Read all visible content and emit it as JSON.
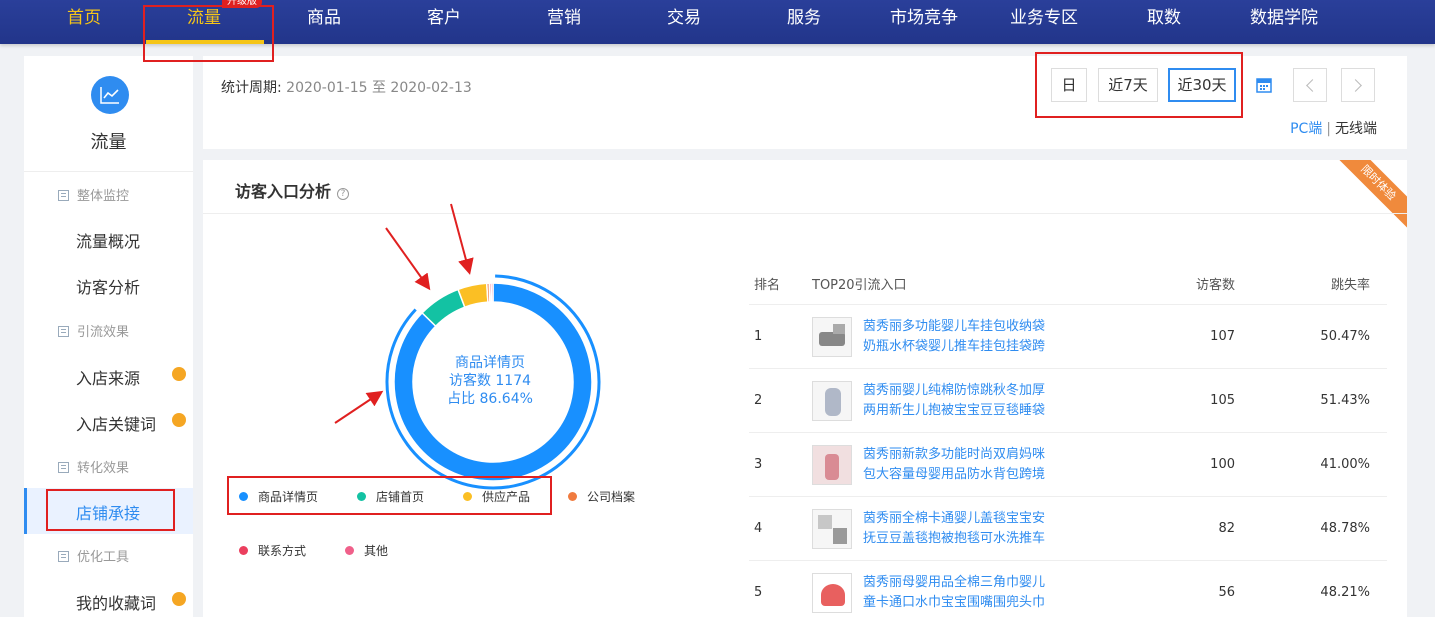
{
  "nav": {
    "items": [
      "首页",
      "流量",
      "商品",
      "客户",
      "营销",
      "交易",
      "服务",
      "市场竞争",
      "业务专区",
      "取数",
      "数据学院"
    ],
    "badge": "升级版",
    "active_index": 1
  },
  "sidebar": {
    "title": "流量",
    "groups": [
      {
        "label": "整体监控",
        "items": [
          "流量概况",
          "访客分析"
        ]
      },
      {
        "label": "引流效果",
        "items": [
          "入店来源",
          "入店关键词"
        ]
      },
      {
        "label": "转化效果",
        "items": [
          "店铺承接"
        ]
      },
      {
        "label": "优化工具",
        "items": [
          "我的收藏词"
        ]
      }
    ],
    "active_item": "店铺承接"
  },
  "header": {
    "period_label": "统计周期:",
    "period_value": "2020-01-15 至 2020-02-13",
    "buttons": [
      "日",
      "近7天",
      "近30天"
    ],
    "selected_button": "近30天",
    "device_pc": "PC端",
    "device_sep": "|",
    "device_wireless": "无线端"
  },
  "panel": {
    "title": "访客入口分析",
    "help_icon": "?",
    "ribbon": "限时体验",
    "donut_center": {
      "label": "商品详情页",
      "visits": "访客数 1174",
      "share": "占比 86.64%"
    },
    "legend": [
      {
        "name": "商品详情页",
        "color": "#1890ff"
      },
      {
        "name": "店铺首页",
        "color": "#13c2a3"
      },
      {
        "name": "供应产品",
        "color": "#fbbf24"
      },
      {
        "name": "公司档案",
        "color": "#f07b3f"
      },
      {
        "name": "联系方式",
        "color": "#eb3f5e"
      },
      {
        "name": "其他",
        "color": "#f0608a"
      }
    ],
    "donut_shares": [
      86.64,
      6.9,
      4.7,
      0.4,
      0.3,
      0.3
    ],
    "table": {
      "headers": [
        "排名",
        "TOP20引流入口",
        "访客数",
        "跳失率"
      ],
      "rows": [
        {
          "rank": "1",
          "name_line1": "茵秀丽多功能婴儿车挂包收纳袋",
          "name_line2": "奶瓶水杯袋婴儿推车挂包挂袋跨",
          "visits": "107",
          "bounce": "50.47%"
        },
        {
          "rank": "2",
          "name_line1": "茵秀丽婴儿纯棉防惊跳秋冬加厚",
          "name_line2": "两用新生儿抱被宝宝豆豆毯睡袋",
          "visits": "105",
          "bounce": "51.43%"
        },
        {
          "rank": "3",
          "name_line1": "茵秀丽新款多功能时尚双肩妈咪",
          "name_line2": "包大容量母婴用品防水背包跨境",
          "visits": "100",
          "bounce": "41.00%"
        },
        {
          "rank": "4",
          "name_line1": "茵秀丽全棉卡通婴儿盖毯宝宝安",
          "name_line2": "抚豆豆盖毯抱被抱毯可水洗推车",
          "visits": "82",
          "bounce": "48.78%"
        },
        {
          "rank": "5",
          "name_line1": "茵秀丽母婴用品全棉三角巾婴儿",
          "name_line2": "童卡通口水巾宝宝围嘴围兜头巾",
          "visits": "56",
          "bounce": "48.21%"
        }
      ]
    }
  }
}
